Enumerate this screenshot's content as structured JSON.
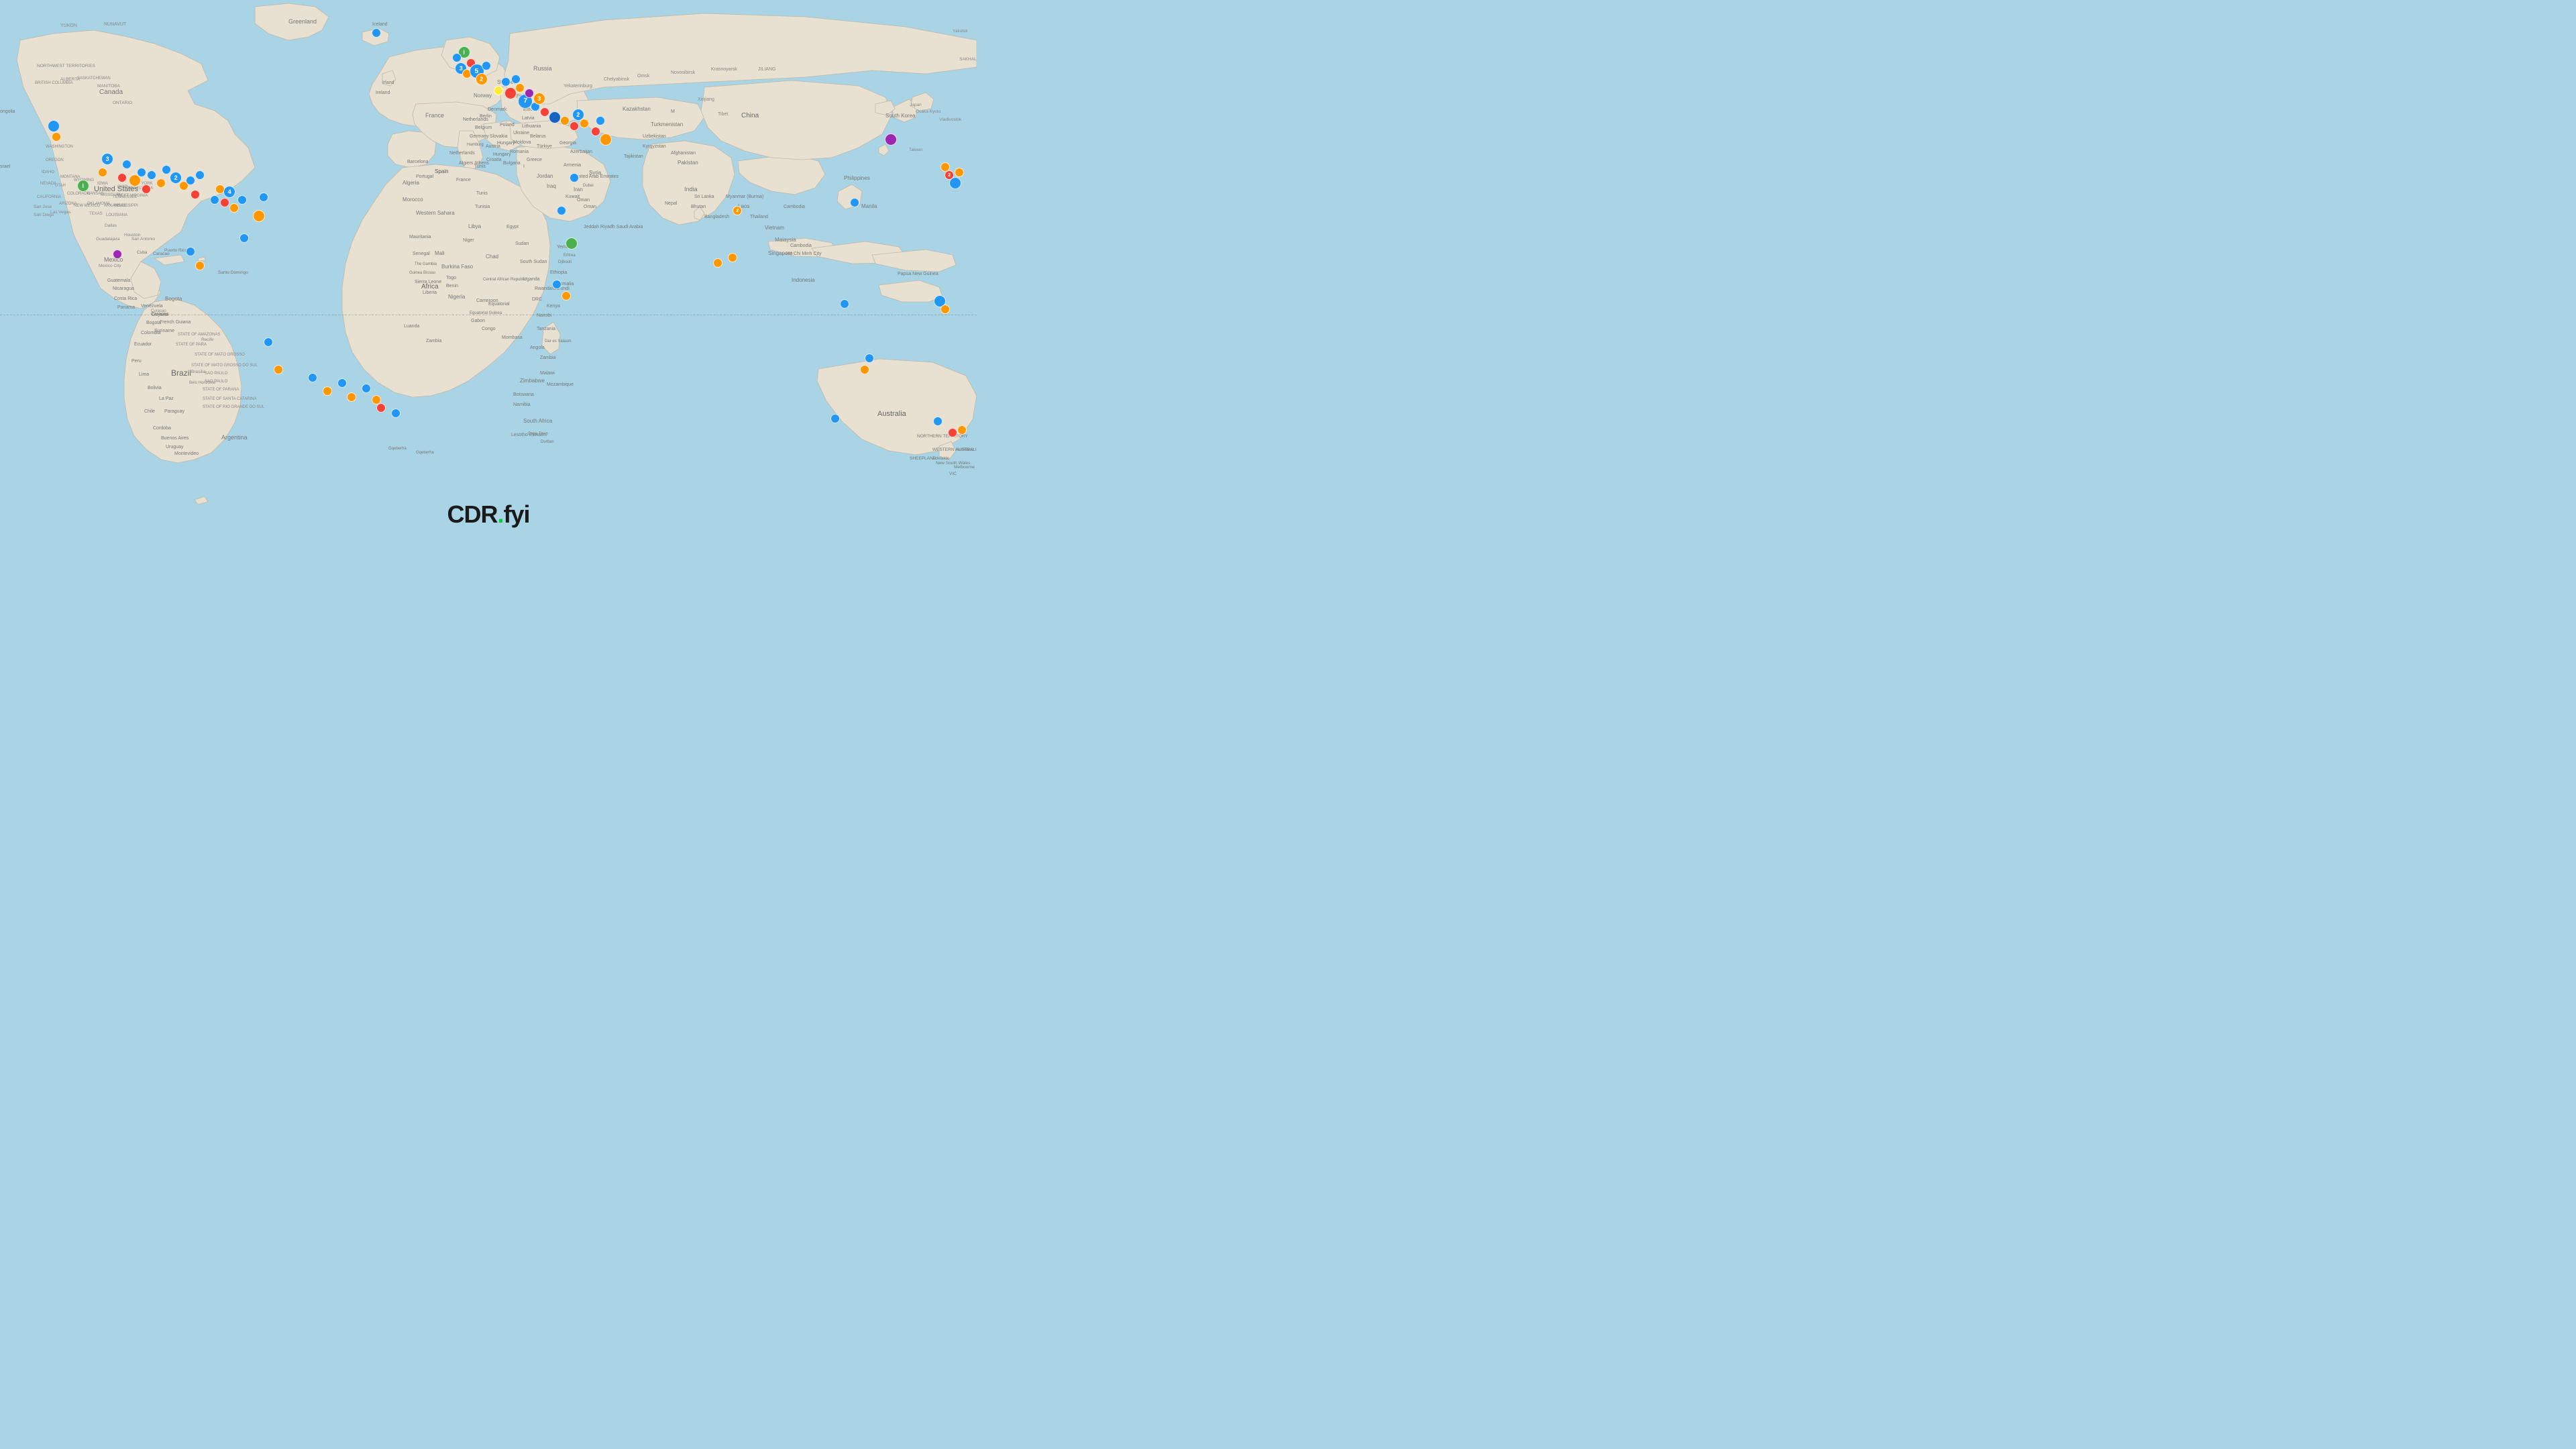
{
  "brand": {
    "name": "CDR",
    "dot": ".",
    "suffix": "fyi"
  },
  "map": {
    "background_color": "#a8d4e6",
    "land_color": "#f0ece4",
    "border_color": "#c8c0b0"
  },
  "markers": [
    {
      "id": "m1",
      "color": "blue",
      "size": "md",
      "x": 5.2,
      "y": 22.5,
      "label": ""
    },
    {
      "id": "m2",
      "color": "orange",
      "size": "sm",
      "x": 5.5,
      "y": 24.5,
      "label": ""
    },
    {
      "id": "m3",
      "color": "blue",
      "size": "sm",
      "x": 7.0,
      "y": 27.5,
      "label": ""
    },
    {
      "id": "m4",
      "color": "red",
      "size": "sm",
      "x": 7.2,
      "y": 26.8,
      "label": ""
    },
    {
      "id": "m5",
      "color": "green",
      "size": "md",
      "x": 8.5,
      "y": 33.5,
      "label": "i"
    },
    {
      "id": "m6",
      "color": "blue",
      "size": "sm",
      "x": 9.5,
      "y": 28.5,
      "label": ""
    },
    {
      "id": "m7",
      "color": "orange",
      "size": "sm",
      "x": 10.2,
      "y": 31.5,
      "label": ""
    },
    {
      "id": "m8",
      "color": "blue",
      "size": "md",
      "x": 11.0,
      "y": 29.0,
      "label": "3"
    },
    {
      "id": "m9",
      "color": "red",
      "size": "sm",
      "x": 12.5,
      "y": 32.5,
      "label": ""
    },
    {
      "id": "m10",
      "color": "blue",
      "size": "sm",
      "x": 13.0,
      "y": 30.0,
      "label": ""
    },
    {
      "id": "m11",
      "color": "orange",
      "size": "md",
      "x": 13.8,
      "y": 33.0,
      "label": ""
    },
    {
      "id": "m12",
      "color": "blue",
      "size": "sm",
      "x": 14.5,
      "y": 31.5,
      "label": ""
    },
    {
      "id": "m13",
      "color": "red",
      "size": "sm",
      "x": 15.0,
      "y": 34.5,
      "label": ""
    },
    {
      "id": "m14",
      "color": "blue",
      "size": "sm",
      "x": 15.5,
      "y": 32.0,
      "label": ""
    },
    {
      "id": "m15",
      "color": "orange",
      "size": "sm",
      "x": 16.5,
      "y": 33.5,
      "label": ""
    },
    {
      "id": "m16",
      "color": "blue",
      "size": "sm",
      "x": 17.0,
      "y": 31.0,
      "label": ""
    },
    {
      "id": "m17",
      "color": "red",
      "size": "sm",
      "x": 17.5,
      "y": 35.0,
      "label": ""
    },
    {
      "id": "m18",
      "color": "blue",
      "size": "md",
      "x": 18.2,
      "y": 32.5,
      "label": "2"
    },
    {
      "id": "m19",
      "color": "orange",
      "size": "sm",
      "x": 18.8,
      "y": 34.0,
      "label": ""
    },
    {
      "id": "m20",
      "color": "blue",
      "size": "sm",
      "x": 19.5,
      "y": 33.0,
      "label": ""
    },
    {
      "id": "m21",
      "color": "red",
      "size": "sm",
      "x": 20.0,
      "y": 35.5,
      "label": ""
    },
    {
      "id": "m22",
      "color": "blue",
      "size": "sm",
      "x": 20.5,
      "y": 32.0,
      "label": ""
    },
    {
      "id": "m23",
      "color": "purple",
      "size": "sm",
      "x": 12.0,
      "y": 46.5,
      "label": ""
    },
    {
      "id": "m24",
      "color": "blue",
      "size": "sm",
      "x": 22.0,
      "y": 36.5,
      "label": ""
    },
    {
      "id": "m25",
      "color": "orange",
      "size": "sm",
      "x": 22.5,
      "y": 34.5,
      "label": ""
    },
    {
      "id": "m26",
      "color": "red",
      "size": "sm",
      "x": 23.0,
      "y": 37.0,
      "label": ""
    },
    {
      "id": "m27",
      "color": "blue",
      "size": "md",
      "x": 23.5,
      "y": 35.0,
      "label": "4"
    },
    {
      "id": "m28",
      "color": "orange",
      "size": "sm",
      "x": 24.0,
      "y": 38.0,
      "label": ""
    },
    {
      "id": "m29",
      "color": "blue",
      "size": "sm",
      "x": 24.8,
      "y": 36.5,
      "label": ""
    },
    {
      "id": "m30",
      "color": "red",
      "size": "sm",
      "x": 25.3,
      "y": 35.0,
      "label": ""
    },
    {
      "id": "m31",
      "color": "blue",
      "size": "sm",
      "x": 25.8,
      "y": 37.5,
      "label": ""
    },
    {
      "id": "m32",
      "color": "orange",
      "size": "md",
      "x": 26.5,
      "y": 39.5,
      "label": ""
    },
    {
      "id": "m33",
      "color": "blue",
      "size": "sm",
      "x": 27.0,
      "y": 36.0,
      "label": ""
    },
    {
      "id": "m34",
      "color": "purple",
      "size": "sm",
      "x": 22.0,
      "y": 47.0,
      "label": ""
    },
    {
      "id": "m35",
      "color": "blue",
      "size": "sm",
      "x": 19.5,
      "y": 46.0,
      "label": ""
    },
    {
      "id": "m36",
      "color": "orange",
      "size": "sm",
      "x": 20.5,
      "y": 48.5,
      "label": ""
    },
    {
      "id": "m37",
      "color": "green",
      "size": "md",
      "x": 47.5,
      "y": 9.5,
      "label": "i"
    },
    {
      "id": "m38",
      "color": "blue",
      "size": "sm",
      "x": 46.8,
      "y": 10.5,
      "label": ""
    },
    {
      "id": "m39",
      "color": "blue",
      "size": "md",
      "x": 47.2,
      "y": 12.5,
      "label": "3"
    },
    {
      "id": "m40",
      "color": "orange",
      "size": "sm",
      "x": 47.8,
      "y": 13.5,
      "label": ""
    },
    {
      "id": "m41",
      "color": "red",
      "size": "sm",
      "x": 48.2,
      "y": 11.5,
      "label": ""
    },
    {
      "id": "m42",
      "color": "blue",
      "size": "lg",
      "x": 48.8,
      "y": 13.0,
      "label": "5"
    },
    {
      "id": "m43",
      "color": "orange",
      "size": "md",
      "x": 49.3,
      "y": 14.5,
      "label": "2"
    },
    {
      "id": "m44",
      "color": "blue",
      "size": "sm",
      "x": 49.8,
      "y": 12.0,
      "label": ""
    },
    {
      "id": "m45",
      "color": "red",
      "size": "sm",
      "x": 50.2,
      "y": 14.0,
      "label": ""
    },
    {
      "id": "m46",
      "color": "blue",
      "size": "md",
      "x": 50.8,
      "y": 15.5,
      "label": ""
    },
    {
      "id": "m47",
      "color": "orange",
      "size": "sm",
      "x": 51.2,
      "y": 13.5,
      "label": ""
    },
    {
      "id": "m48",
      "color": "yellow",
      "size": "sm",
      "x": 51.0,
      "y": 16.5,
      "label": ""
    },
    {
      "id": "m49",
      "color": "blue",
      "size": "sm",
      "x": 51.8,
      "y": 15.0,
      "label": ""
    },
    {
      "id": "m50",
      "color": "red",
      "size": "md",
      "x": 52.3,
      "y": 17.0,
      "label": ""
    },
    {
      "id": "m51",
      "color": "blue",
      "size": "sm",
      "x": 52.8,
      "y": 14.5,
      "label": ""
    },
    {
      "id": "m52",
      "color": "orange",
      "size": "sm",
      "x": 53.2,
      "y": 16.0,
      "label": ""
    },
    {
      "id": "m53",
      "color": "blue",
      "size": "lg",
      "x": 53.8,
      "y": 18.5,
      "label": "7"
    },
    {
      "id": "m54",
      "color": "purple",
      "size": "sm",
      "x": 54.2,
      "y": 17.0,
      "label": ""
    },
    {
      "id": "m55",
      "color": "blue",
      "size": "sm",
      "x": 54.8,
      "y": 19.5,
      "label": ""
    },
    {
      "id": "m56",
      "color": "orange",
      "size": "md",
      "x": 55.2,
      "y": 18.0,
      "label": "3"
    },
    {
      "id": "m57",
      "color": "red",
      "size": "sm",
      "x": 55.8,
      "y": 20.5,
      "label": ""
    },
    {
      "id": "m58",
      "color": "blue",
      "size": "sm",
      "x": 56.2,
      "y": 19.0,
      "label": ""
    },
    {
      "id": "m59",
      "color": "darkblue",
      "size": "md",
      "x": 56.8,
      "y": 21.5,
      "label": ""
    },
    {
      "id": "m60",
      "color": "blue",
      "size": "sm",
      "x": 57.2,
      "y": 20.0,
      "label": ""
    },
    {
      "id": "m61",
      "color": "orange",
      "size": "sm",
      "x": 57.8,
      "y": 22.0,
      "label": ""
    },
    {
      "id": "m62",
      "color": "blue",
      "size": "sm",
      "x": 58.2,
      "y": 19.5,
      "label": ""
    },
    {
      "id": "m63",
      "color": "red",
      "size": "sm",
      "x": 58.8,
      "y": 23.0,
      "label": ""
    },
    {
      "id": "m64",
      "color": "blue",
      "size": "md",
      "x": 59.2,
      "y": 21.0,
      "label": "2"
    },
    {
      "id": "m65",
      "color": "orange",
      "size": "sm",
      "x": 59.8,
      "y": 22.5,
      "label": ""
    },
    {
      "id": "m66",
      "color": "blue",
      "size": "sm",
      "x": 60.5,
      "y": 20.0,
      "label": ""
    },
    {
      "id": "m67",
      "color": "red",
      "size": "sm",
      "x": 61.0,
      "y": 24.0,
      "label": ""
    },
    {
      "id": "m68",
      "color": "blue",
      "size": "sm",
      "x": 61.5,
      "y": 22.0,
      "label": ""
    },
    {
      "id": "m69",
      "color": "orange",
      "size": "md",
      "x": 62.0,
      "y": 25.5,
      "label": ""
    },
    {
      "id": "m70",
      "color": "blue",
      "size": "sm",
      "x": 62.8,
      "y": 23.5,
      "label": ""
    },
    {
      "id": "m71",
      "color": "purple",
      "size": "md",
      "x": 91.2,
      "y": 25.5,
      "label": ""
    },
    {
      "id": "m72",
      "color": "blue",
      "size": "sm",
      "x": 57.5,
      "y": 38.5,
      "label": ""
    },
    {
      "id": "m73",
      "color": "orange",
      "size": "sm",
      "x": 75.5,
      "y": 38.5,
      "label": "2"
    },
    {
      "id": "m74",
      "color": "blue",
      "size": "sm",
      "x": 58.8,
      "y": 32.5,
      "label": ""
    },
    {
      "id": "m75",
      "color": "orange",
      "size": "sm",
      "x": 73.5,
      "y": 48.0,
      "label": ""
    },
    {
      "id": "m76",
      "color": "blue",
      "size": "sm",
      "x": 87.5,
      "y": 37.0,
      "label": ""
    },
    {
      "id": "m77",
      "color": "orange",
      "size": "sm",
      "x": 96.8,
      "y": 30.5,
      "label": ""
    },
    {
      "id": "m78",
      "color": "red",
      "size": "sm",
      "x": 97.2,
      "y": 32.0,
      "label": "2"
    },
    {
      "id": "m79",
      "color": "blue",
      "size": "md",
      "x": 97.8,
      "y": 33.5,
      "label": ""
    },
    {
      "id": "m80",
      "color": "orange",
      "size": "sm",
      "x": 98.2,
      "y": 31.5,
      "label": ""
    },
    {
      "id": "m81",
      "color": "blue",
      "size": "sm",
      "x": 98.8,
      "y": 34.0,
      "label": ""
    },
    {
      "id": "m82",
      "color": "red",
      "size": "sm",
      "x": 99.2,
      "y": 32.5,
      "label": ""
    },
    {
      "id": "m83",
      "color": "blue",
      "size": "sm",
      "x": 86.5,
      "y": 55.5,
      "label": ""
    },
    {
      "id": "m84",
      "color": "orange",
      "size": "sm",
      "x": 88.5,
      "y": 67.5,
      "label": ""
    },
    {
      "id": "m85",
      "color": "blue",
      "size": "sm",
      "x": 89.0,
      "y": 65.5,
      "label": ""
    },
    {
      "id": "m86",
      "color": "green",
      "size": "md",
      "x": 58.5,
      "y": 44.5,
      "label": ""
    },
    {
      "id": "m87",
      "color": "blue",
      "size": "sm",
      "x": 27.5,
      "y": 62.5,
      "label": ""
    },
    {
      "id": "m88",
      "color": "orange",
      "size": "sm",
      "x": 28.5,
      "y": 67.5,
      "label": ""
    },
    {
      "id": "m89",
      "color": "blue",
      "size": "sm",
      "x": 32.0,
      "y": 69.0,
      "label": ""
    },
    {
      "id": "m90",
      "color": "orange",
      "size": "sm",
      "x": 33.5,
      "y": 71.5,
      "label": ""
    },
    {
      "id": "m91",
      "color": "blue",
      "size": "sm",
      "x": 35.0,
      "y": 70.0,
      "label": ""
    },
    {
      "id": "m92",
      "color": "orange",
      "size": "sm",
      "x": 36.0,
      "y": 72.5,
      "label": ""
    },
    {
      "id": "m93",
      "color": "blue",
      "size": "sm",
      "x": 37.5,
      "y": 71.0,
      "label": ""
    },
    {
      "id": "m94",
      "color": "orange",
      "size": "sm",
      "x": 38.5,
      "y": 73.0,
      "label": ""
    },
    {
      "id": "m95",
      "color": "red",
      "size": "sm",
      "x": 39.0,
      "y": 74.5,
      "label": ""
    },
    {
      "id": "m96",
      "color": "blue",
      "size": "sm",
      "x": 40.5,
      "y": 75.5,
      "label": ""
    },
    {
      "id": "m97",
      "color": "orange",
      "size": "sm",
      "x": 41.5,
      "y": 73.0,
      "label": ""
    },
    {
      "id": "m98",
      "color": "blue",
      "size": "sm",
      "x": 25.0,
      "y": 43.5,
      "label": ""
    },
    {
      "id": "m99",
      "color": "blue",
      "size": "md",
      "x": 96.2,
      "y": 55.0,
      "label": ""
    },
    {
      "id": "m100",
      "color": "orange",
      "size": "sm",
      "x": 96.8,
      "y": 56.5,
      "label": ""
    }
  ],
  "country_label": "Spain",
  "equator_y": 57.5
}
